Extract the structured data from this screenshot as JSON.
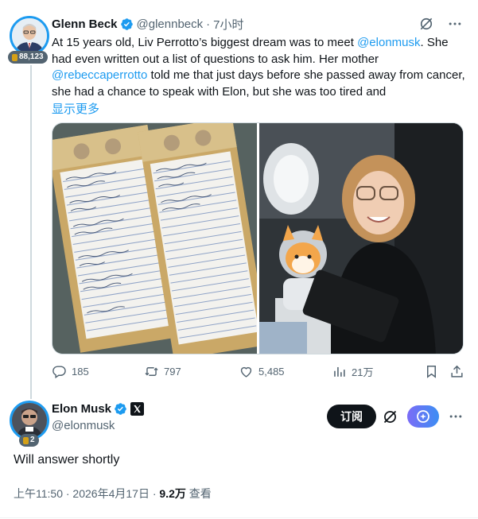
{
  "tweet1": {
    "author_name": "Glenn Beck",
    "handle": "@glennbeck",
    "separator": "·",
    "time": "7小时",
    "badge_count": "88,123",
    "text_parts": [
      {
        "t": "At 15 years old, Liv Perrotto’s biggest dream was to meet ",
        "link": false
      },
      {
        "t": "@elonmusk",
        "link": true
      },
      {
        "t": ". She had even written out a list of questions to ask him. Her mother ",
        "link": false
      },
      {
        "t": "@rebeccaperrotto",
        "link": true
      },
      {
        "t": " told me that just days before she passed away from cancer, she had a chance to speak with Elon, but she was too tired and",
        "link": false
      }
    ],
    "show_more": "显示更多",
    "actions": {
      "replies": "185",
      "reposts": "797",
      "likes": "5,485",
      "views": "21万"
    }
  },
  "tweet2": {
    "author_name": "Elon Musk",
    "handle": "@elonmusk",
    "badge_count": "2",
    "subscribe_label": "订阅",
    "text": "Will answer shortly",
    "time_date": "上午11:50 · 2026年4月17日 · ",
    "views_count": "9.2万",
    "views_label": " 查看"
  },
  "colors": {
    "accent": "#1d9bf0",
    "text": "#0f1419",
    "muted": "#536471"
  },
  "icons": [
    "verified-badge-icon",
    "grok-icon",
    "more-icon",
    "reply-icon",
    "repost-icon",
    "like-icon",
    "views-icon",
    "bookmark-icon",
    "share-icon",
    "x-logo-icon"
  ]
}
